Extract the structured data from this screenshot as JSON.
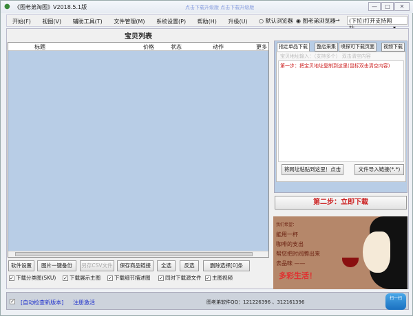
{
  "window": {
    "title": "《图老弟淘图》V2018.5.1版",
    "title_links": "点击下载升级版 点击下载升级版",
    "minimize": "—",
    "maximize": "□",
    "close": "✕"
  },
  "menu": [
    "开始(F)",
    "视图(V)",
    "辅助工具(T)",
    "文件管理(M)",
    "系统设置(P)",
    "帮助(H)",
    "升级(U)"
  ],
  "browser": {
    "option1": "默认浏览器",
    "option2": "图老弟浏览器",
    "arrow": "→",
    "dropdown": "(下拉)打开支持网站"
  },
  "list": {
    "title": "宝贝列表",
    "columns": [
      "标题",
      "价格",
      "状态",
      "动作",
      "更多"
    ]
  },
  "buttons": [
    "软件设置",
    "图片一键备份",
    "另存CSV文件",
    "保存商品链接",
    "全选",
    "反选",
    "删除选择[0]条"
  ],
  "checkboxes": [
    "下载分类图(SKU)",
    "下载展示主图",
    "下载细节描述图",
    "同时下载源文件",
    "主图视频"
  ],
  "right": {
    "tabs": [
      "指定单品下载",
      "整店采集",
      "嗅探可下载页面",
      "视频下载"
    ],
    "hint": "宝贝地址输入：（支持多个）   双击清空内容",
    "step1": "第一步：把宝贝地址复制到这里(鼠标双击清空内容)",
    "paste_button": "将网址粘贴到这里！点击",
    "import_button": "文件导入链接(*.*)",
    "step2": "第二步：立即下载"
  },
  "ad": {
    "lines": [
      "我们希望：",
      "能用一杯",
      "咖啡的支出",
      "帮您把时间腾出来",
      "去品味 ——"
    ],
    "slogan": "多彩生活！"
  },
  "status": {
    "auto_check": "[自动检查新版本]",
    "register": "注册激活",
    "qq": "图老弟软件QQ：121226396 、312161396",
    "scan": "扫一扫"
  },
  "colors": {
    "list_bg": "#b8cde6",
    "step_red": "#cc2222",
    "ad_bg": "#b5876a"
  }
}
